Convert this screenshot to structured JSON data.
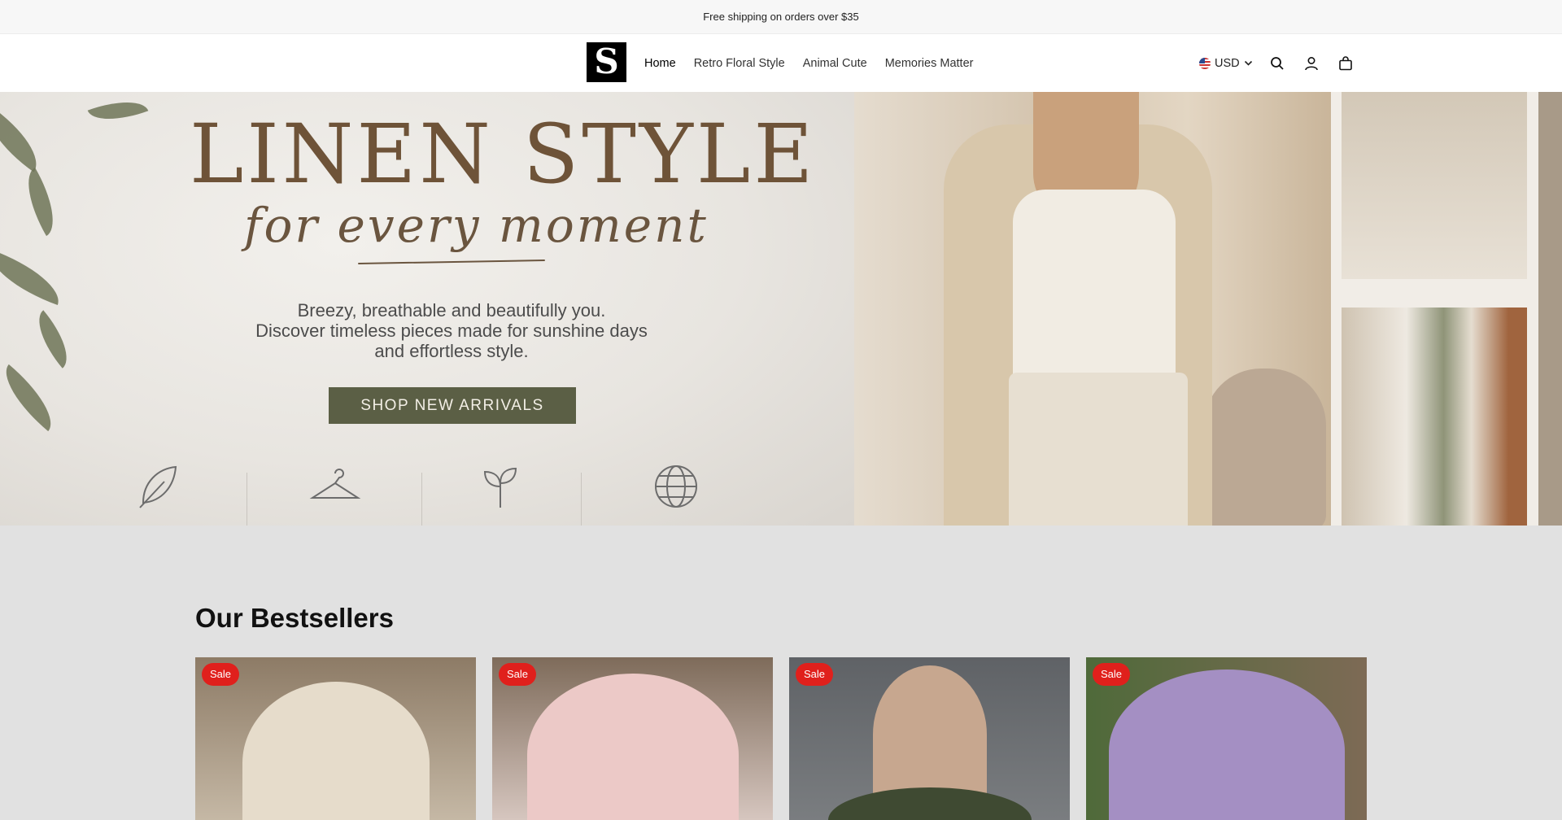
{
  "announcement": "Free shipping on orders over $35",
  "logo": "S",
  "nav": [
    "Home",
    "Retro Floral Style",
    "Animal Cute",
    "Memories Matter"
  ],
  "utilities": {
    "currency": "USD",
    "icons": [
      "search-icon",
      "account-icon",
      "cart-icon"
    ]
  },
  "hero": {
    "heading": "LINEN STYLE",
    "script": "for every moment",
    "subtitle_lines": [
      "Breezy, breathable and beautifully you.",
      "Discover timeless pieces made for sunshine days",
      "and effortless style."
    ],
    "cta": "SHOP NEW ARRIVALS",
    "feature_icons": [
      "leaf-icon",
      "hanger-icon",
      "sprout-icon",
      "globe-icon"
    ]
  },
  "bestsellers": {
    "title": "Our Bestsellers",
    "products": [
      {
        "badge": "Sale"
      },
      {
        "badge": "Sale"
      },
      {
        "badge": "Sale"
      },
      {
        "badge": "Sale"
      }
    ]
  },
  "colors": {
    "sale_badge": "#e0201c",
    "cta_bg": "#5b5f45",
    "heading_brown": "#6e5338"
  }
}
